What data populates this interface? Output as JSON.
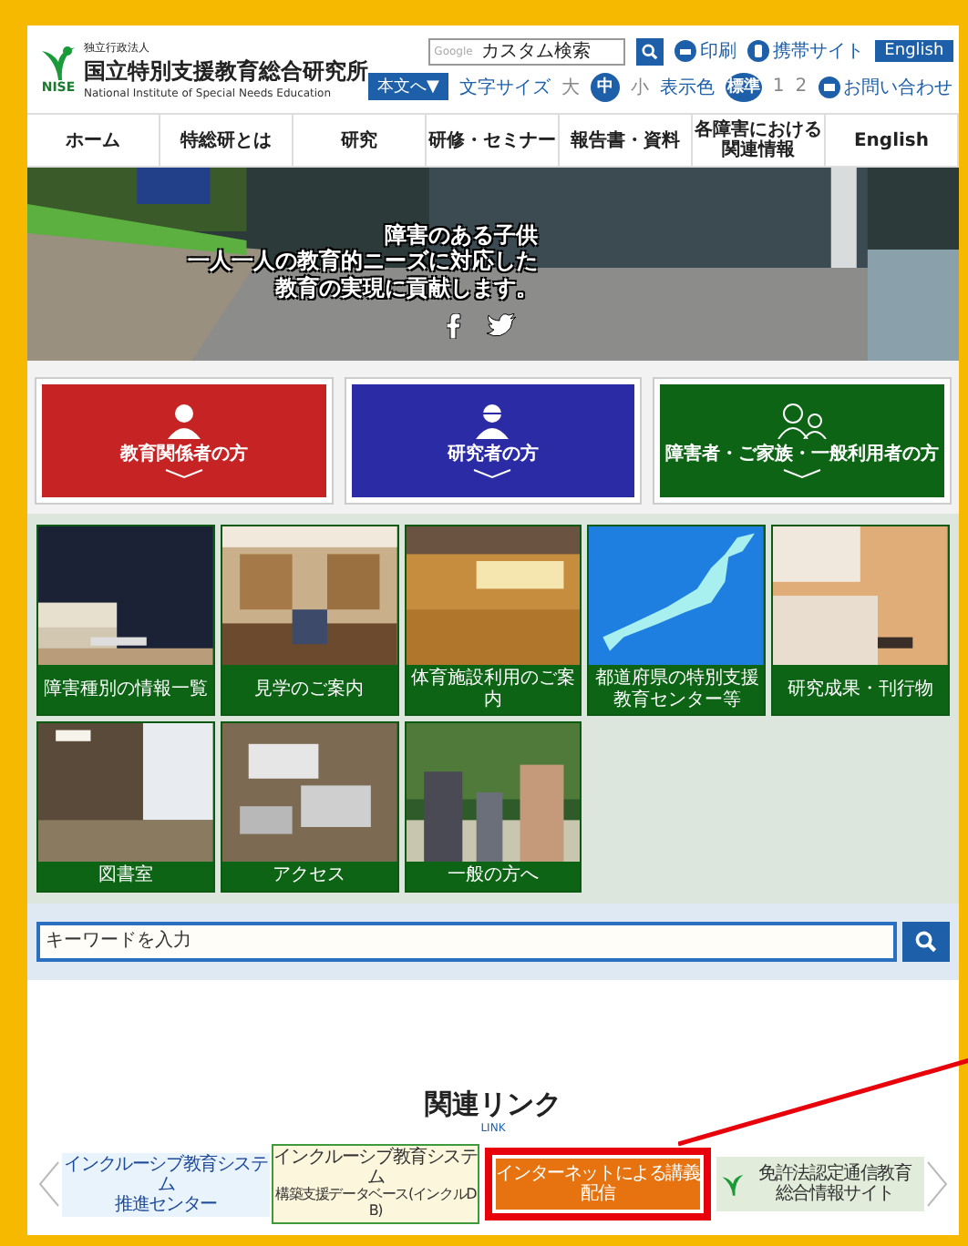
{
  "header": {
    "logo_text": "NISE",
    "org_type": "独立行政法人",
    "org_name": "国立特別支援教育総合研究所",
    "org_name_en": "National Institute of Special Needs Education",
    "search": {
      "brand": "Google",
      "placeholder": "カスタム検索"
    },
    "tools": [
      {
        "label": "印刷",
        "kind": "print"
      },
      {
        "label": "携帯サイト",
        "kind": "mobile"
      }
    ],
    "english_button": "English",
    "skip_button": "本文へ▼",
    "font_size": {
      "label": "文字サイズ",
      "options": [
        {
          "label": "大",
          "selected": false
        },
        {
          "label": "中",
          "selected": true
        },
        {
          "label": "小",
          "selected": false
        }
      ]
    },
    "display_color": {
      "label": "表示色",
      "options": [
        {
          "label": "標準",
          "selected": true
        },
        {
          "label": "1",
          "selected": false
        },
        {
          "label": "2",
          "selected": false
        }
      ]
    },
    "contact": "お問い合わせ"
  },
  "nav": [
    "ホーム",
    "特総研とは",
    "研究",
    "研修・セミナー",
    "報告書・資料",
    "各障害における関連情報",
    "English"
  ],
  "hero": {
    "lines": [
      "障害のある子供",
      "一人一人の教育的ニーズに対応した",
      "教育の実現に貢献します。"
    ]
  },
  "audience_cards": [
    {
      "label": "教育関係者の方",
      "color": "#c62324",
      "kind": "person"
    },
    {
      "label": "研究者の方",
      "color": "#2b2ba6",
      "kind": "glasses"
    },
    {
      "label": "障害者・ご家族・一般利用者の方",
      "color": "#0c6414",
      "kind": "family"
    }
  ],
  "tiles": [
    {
      "label": "障害種別の情報一覧"
    },
    {
      "label": "見学のご案内"
    },
    {
      "label": "体育施設利用のご案内"
    },
    {
      "label": "都道府県の特別支援教育センター等"
    },
    {
      "label": "研究成果・刊行物"
    },
    {
      "label": "図書室"
    },
    {
      "label": "アクセス"
    },
    {
      "label": "一般の方へ"
    }
  ],
  "site_search": {
    "placeholder": "キーワードを入力"
  },
  "related_links": {
    "title": "関連リンク",
    "subtitle": "LINK",
    "banners": [
      {
        "kind": "bubbles",
        "lines": [
          "インクルーシブ教育システム",
          "推進センター"
        ],
        "highlighted": false
      },
      {
        "kind": "framed",
        "lines": [
          "インクルーシブ教育システム",
          "構築支援データベース(インクルDB)"
        ],
        "highlighted": false
      },
      {
        "kind": "orange",
        "lines": [
          "インターネットによる講義配信"
        ],
        "highlighted": true
      },
      {
        "kind": "logo",
        "lines": [
          "免許法認定通信教育",
          "総合情報サイト"
        ],
        "highlighted": false
      }
    ]
  }
}
